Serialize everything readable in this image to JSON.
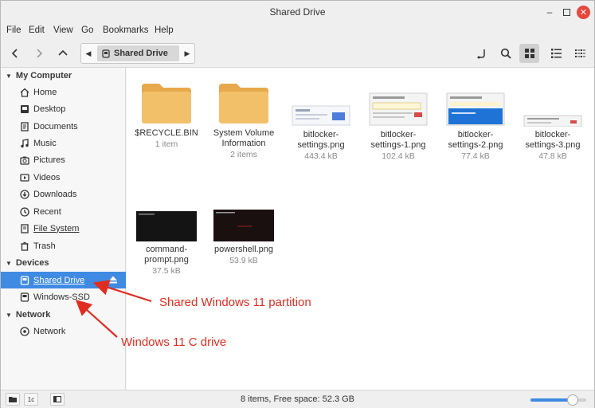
{
  "window": {
    "title": "Shared Drive"
  },
  "menu": [
    "File",
    "Edit",
    "View",
    "Go",
    "Bookmarks",
    "Help"
  ],
  "path": {
    "current": "Shared Drive"
  },
  "sidebar": {
    "sections": [
      {
        "header": "My Computer",
        "items": [
          "Home",
          "Desktop",
          "Documents",
          "Music",
          "Pictures",
          "Videos",
          "Downloads",
          "Recent",
          "File System",
          "Trash"
        ]
      },
      {
        "header": "Devices",
        "items": [
          "Shared Drive",
          "Windows-SSD"
        ]
      },
      {
        "header": "Network",
        "items": [
          "Network"
        ]
      }
    ]
  },
  "files": [
    {
      "name": "$RECYCLE.BIN",
      "meta": "1 item",
      "kind": "folder"
    },
    {
      "name": "System Volume Information",
      "name1": "System Volume",
      "name2": "Information",
      "meta": "2 items",
      "kind": "folder"
    },
    {
      "name1": "bitlocker-",
      "name2": "settings.png",
      "meta": "443.4 kB",
      "kind": "image"
    },
    {
      "name1": "bitlocker-",
      "name2": "settings-1.png",
      "meta": "102.4 kB",
      "kind": "image"
    },
    {
      "name1": "bitlocker-",
      "name2": "settings-2.png",
      "meta": "77.4 kB",
      "kind": "image"
    },
    {
      "name1": "bitlocker-",
      "name2": "settings-3.png",
      "meta": "47.8 kB",
      "kind": "image"
    },
    {
      "name1": "command-",
      "name2": "prompt.png",
      "meta": "37.5 kB",
      "kind": "image"
    },
    {
      "name1": "powershell.png",
      "name2": "",
      "meta": "53.9 kB",
      "kind": "image"
    }
  ],
  "status": {
    "text": "8 items, Free space: 52.3 GB",
    "zoom_fraction": 0.75
  },
  "annotations": {
    "shared": "Shared Windows 11 partition",
    "c_drive": "Windows 11 C drive"
  },
  "colors": {
    "accent": "#3f8ae2",
    "folder": "#f0b75a",
    "annotation": "#e12d20"
  }
}
